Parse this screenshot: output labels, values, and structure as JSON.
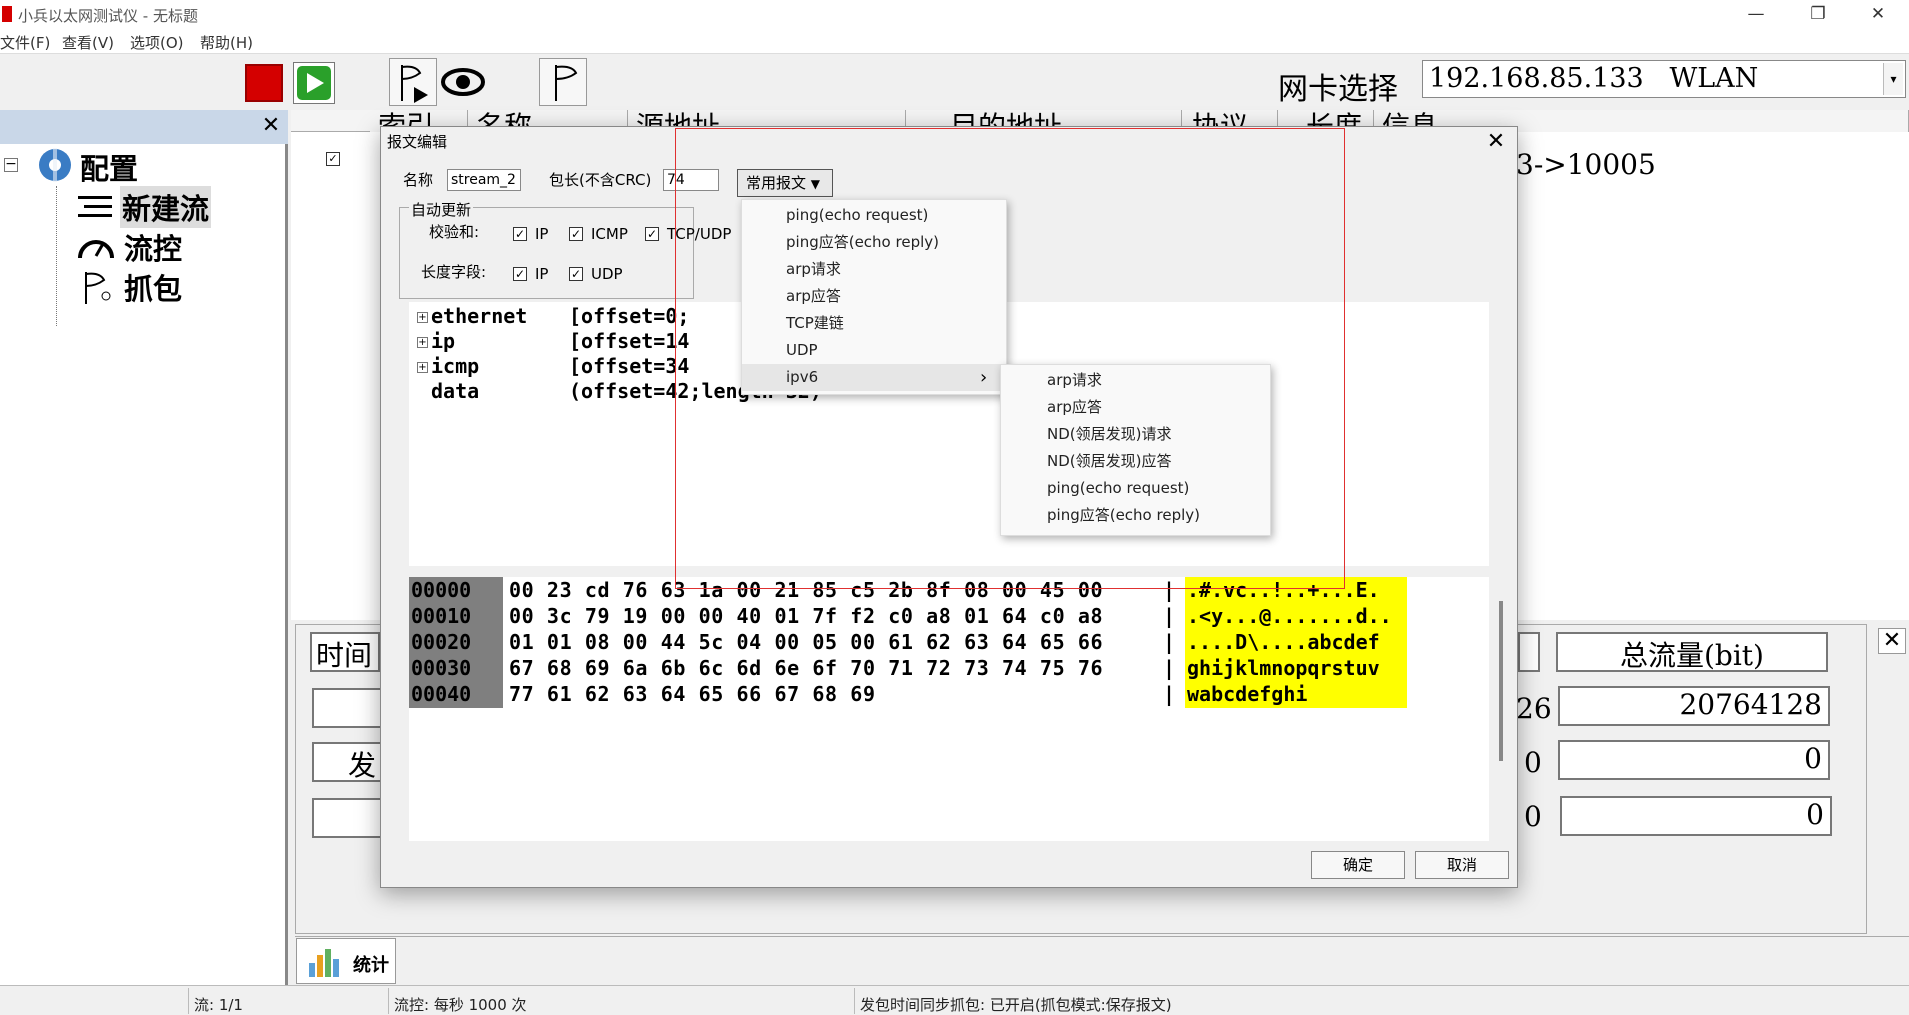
{
  "window": {
    "title": "小兵以太网测试仪 - 无标题",
    "minimize": "—",
    "maximize": "❐",
    "close": "✕"
  },
  "menu": [
    "文件(F)",
    "查看(V)",
    "选项(O)",
    "帮助(H)"
  ],
  "toolbar": {
    "nic_label": "网卡选择",
    "nic_value": "192.168.85.133   WLAN",
    "nic_arrow": "▾"
  },
  "left_panel": {
    "close": "✕",
    "tree": {
      "collapse": "−",
      "root": "配置",
      "items": [
        "新建流",
        "流控",
        "抓包"
      ]
    }
  },
  "grid": {
    "headers": [
      "索引",
      "名称",
      "源地址",
      "目的地址",
      "协议",
      "长度",
      "信息"
    ],
    "visible_cell": "3->10005"
  },
  "stats": {
    "close": "✕",
    "left_header": "时间",
    "left_row2": "发",
    "total_header": "总流量(bit)",
    "partial_values": [
      "26",
      "0",
      "0"
    ],
    "totals": [
      "20764128",
      "0",
      "0"
    ]
  },
  "tabs": {
    "stats_label": "统计"
  },
  "statusbar": [
    "流: 1/1",
    "流控: 每秒 1000 次",
    "发包时间同步抓包: 已开启(抓包模式:保存报文)"
  ],
  "dialog": {
    "title": "报文编辑",
    "close": "✕",
    "name_label": "名称",
    "name_value": "stream_2",
    "len_label": "包长(不含CRC)",
    "len_value": "74",
    "common_button": "常用报文",
    "common_arrow": "▼",
    "auto_update": "自动更新",
    "checksum_label": "校验和:",
    "checksum_opts": [
      "IP",
      "ICMP",
      "TCP/UDP"
    ],
    "length_label": "长度字段:",
    "length_opts": [
      "IP",
      "UDP"
    ],
    "check_mark": "✓",
    "tree": [
      {
        "name": "ethernet",
        "info": "[offset=0;"
      },
      {
        "name": "ip",
        "info": "[offset=14"
      },
      {
        "name": "icmp",
        "info": "[offset=34"
      },
      {
        "name": "data",
        "info": "(offset=42;length=32)"
      }
    ],
    "hex": {
      "offsets": [
        "00000",
        "00010",
        "00020",
        "00030",
        "00040"
      ],
      "bytes": [
        "00 23 cd 76 63 1a 00 21 85 c5 2b 8f 08 00 45 00",
        "00 3c 79 19 00 00 40 01 7f f2 c0 a8 01 64 c0 a8",
        "01 01 08 00 44 5c 04 00 05 00 61 62 63 64 65 66",
        "67 68 69 6a 6b 6c 6d 6e 6f 70 71 72 73 74 75 76",
        "77 61 62 63 64 65 66 67 68 69"
      ],
      "sep": "|",
      "ascii": [
        ".#.vc..!..+...E.",
        ".<y...@.......d..",
        "....D\\....abcdef",
        "ghijklmnopqrstuv",
        "wabcdefghi"
      ]
    },
    "ok": "确定",
    "cancel": "取消"
  },
  "menu1": {
    "items": [
      "ping(echo request)",
      "ping应答(echo reply)",
      "arp请求",
      "arp应答",
      "TCP建链",
      "UDP",
      "ipv6"
    ],
    "submenu_arrow": "›"
  },
  "menu2": {
    "items": [
      "arp请求",
      "arp应答",
      "ND(领居发现)请求",
      "ND(领居发现)应答",
      "ping(echo request)",
      "ping应答(echo reply)"
    ]
  },
  "colors": {
    "accent_red": "#d40000",
    "play_green": "#2aa02a",
    "hex_ascii_bg": "#ffff00",
    "hex_offset_bg": "#7f7f7f",
    "annotation_red": "#e03030"
  },
  "icons": [
    "stop-icon",
    "play-icon",
    "flag-play-icon",
    "eye-icon",
    "flag-icon",
    "gear-icon",
    "list-icon",
    "gauge-icon",
    "capture-icon",
    "chart-icon"
  ]
}
